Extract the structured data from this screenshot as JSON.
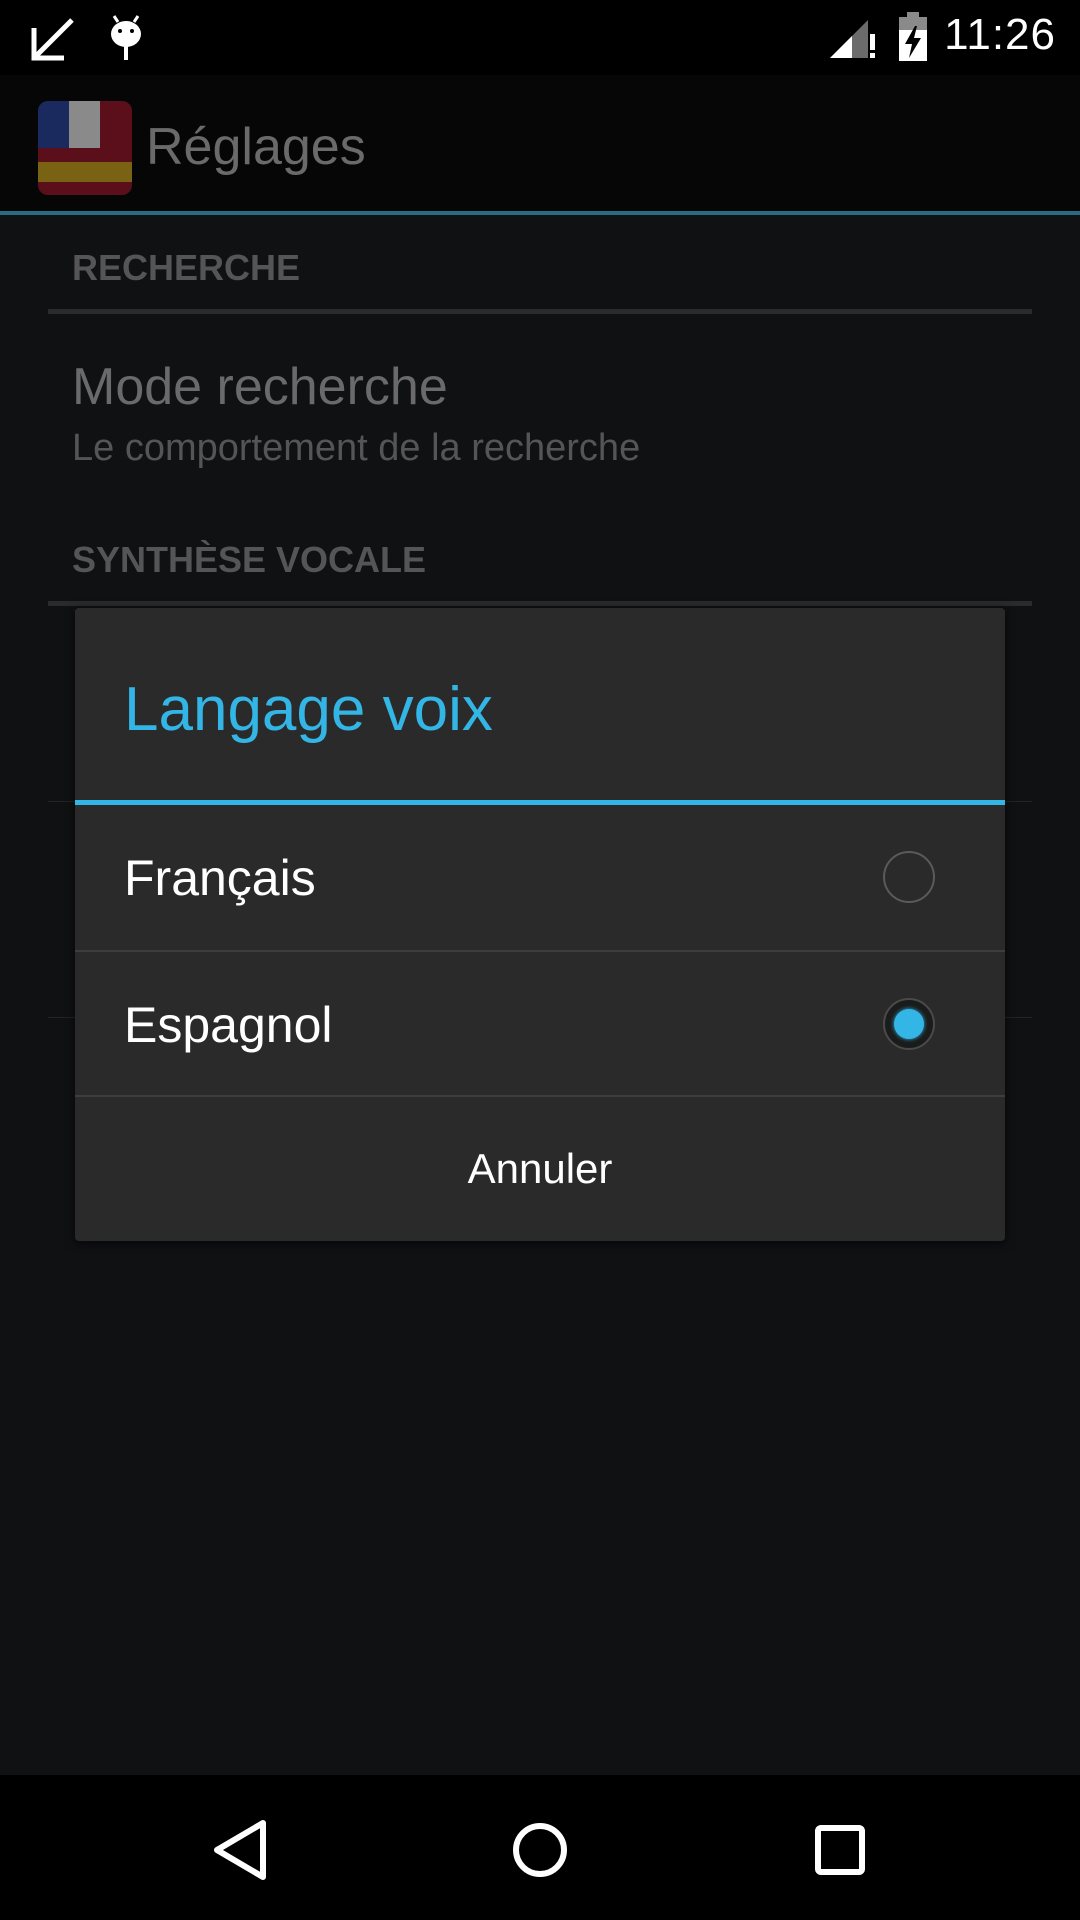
{
  "status_bar": {
    "time": "11:26",
    "icons": [
      "missed-call-arrow-icon",
      "android-debug-icon",
      "signal-icon",
      "battery-charging-icon"
    ]
  },
  "action_bar": {
    "title": "Réglages",
    "app_icon": "flag-app-icon"
  },
  "settings": {
    "section_search": "RECHERCHE",
    "mode_title": "Mode recherche",
    "mode_summary": "Le comportement de la recherche",
    "section_tts": "SYNTHÈSE VOCALE"
  },
  "dialog": {
    "title": "Langage voix",
    "options": [
      {
        "label": "Français",
        "checked": false
      },
      {
        "label": "Espagnol",
        "checked": true
      }
    ],
    "cancel_label": "Annuler"
  },
  "colors": {
    "accent": "#33b5e5",
    "action_bar_divider": "#2a6b83",
    "dialog_bg": "#2a2a2a"
  },
  "nav_bar": {
    "icons": [
      "back-icon",
      "home-icon",
      "recents-icon"
    ]
  }
}
